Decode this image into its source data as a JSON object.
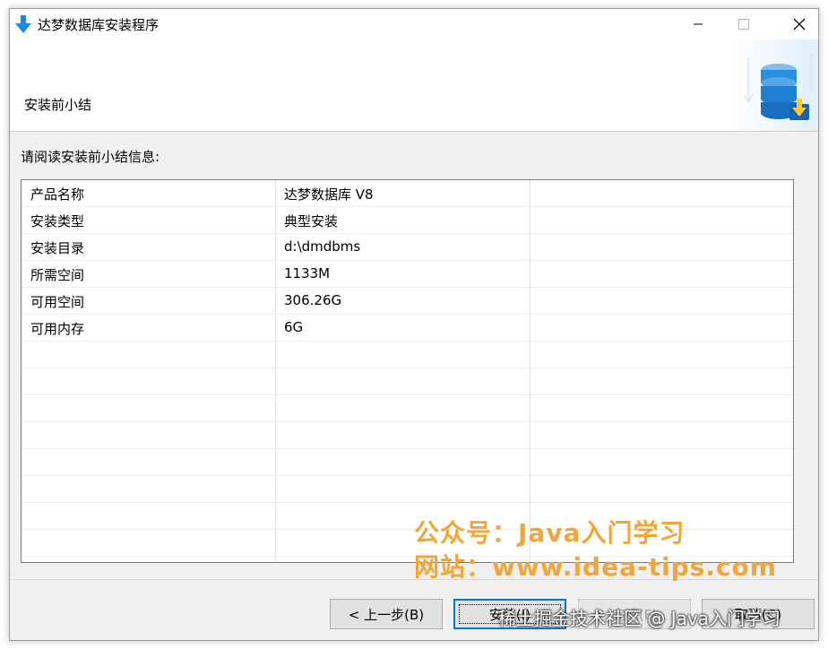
{
  "window": {
    "title": "达梦数据库安装程序",
    "controls": {
      "minimize": "minimize-icon",
      "maximize": "maximize-icon",
      "close": "close-icon"
    }
  },
  "header": {
    "title": "安装前小结",
    "graphic": "database-install-icon"
  },
  "body": {
    "read_label": "请阅读安装前小结信息:",
    "rows": [
      {
        "key": "产品名称",
        "value": "达梦数据库 V8"
      },
      {
        "key": "安装类型",
        "value": "典型安装"
      },
      {
        "key": "安装目录",
        "value": "d:\\dmdbms"
      },
      {
        "key": "所需空间",
        "value": "1133M"
      },
      {
        "key": "可用空间",
        "value": "306.26G"
      },
      {
        "key": "可用内存",
        "value": "6G"
      }
    ]
  },
  "buttons": {
    "back": "< 上一步(B)",
    "install": "安装(I)",
    "finish": "完成(F)",
    "cancel": "取消(C)"
  },
  "watermark": {
    "line1": "公众号：Java入门学习",
    "line2": "网站：www.idea-tips.com",
    "bottom": "稀土掘金技术社区 @ Java入门学习"
  },
  "colors": {
    "accent": "#0078d7",
    "watermark": "#f2a63a"
  }
}
